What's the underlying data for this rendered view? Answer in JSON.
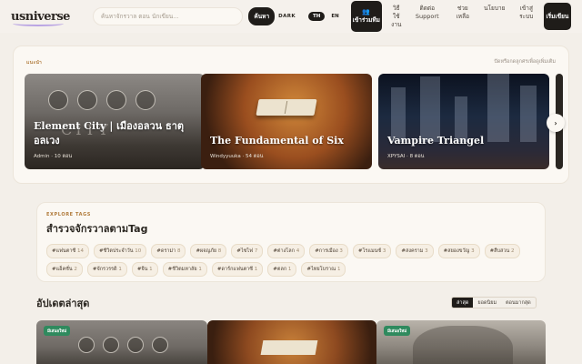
{
  "header": {
    "logo": "usniverse",
    "search_placeholder": "ค้นหาจักรวาล ตอน นักเขียน...",
    "search_button": "ค้นหา",
    "dark_toggle": "DARK",
    "lang_th": "TH",
    "lang_en": "EN",
    "join_label": "เข้าร่วมทีม",
    "nav": [
      {
        "label": "วิธีใช้งาน"
      },
      {
        "label": "ติดต่อ Support"
      },
      {
        "label": "ช่วยเหลือ"
      },
      {
        "label": "นโยบาย"
      },
      {
        "label": "เข้าสู่ระบบ"
      }
    ],
    "login_button": "เริ่มเขียน"
  },
  "hero": {
    "label": "แนะนำ",
    "hint": "ปัดหรือกดลูกศรเพื่อดูเพิ่มเติม",
    "cards": [
      {
        "title": "Element City | เมืองอลวน ธาตุอลเวง",
        "author": "Admin",
        "episodes": "10 ตอน",
        "art_text": "CITY"
      },
      {
        "title": "The Fundamental of Six",
        "author": "Windyyuuka",
        "episodes": "54 ตอน"
      },
      {
        "title": "Vampire Triangel",
        "author": "XPYSAI",
        "episodes": "8 ตอน"
      }
    ]
  },
  "tags": {
    "eyebrow": "EXPLORE TAGS",
    "title": "สำรวจจักรวาลตามTag",
    "items": [
      {
        "name": "#แฟนตาซี",
        "count": "14"
      },
      {
        "name": "#ชีวิตประจำวัน",
        "count": "10"
      },
      {
        "name": "#ดราม่า",
        "count": "8"
      },
      {
        "name": "#ผจญภัย",
        "count": "8"
      },
      {
        "name": "#ไซไฟ",
        "count": "7"
      },
      {
        "name": "#ต่างโลก",
        "count": "4"
      },
      {
        "name": "#การเมือง",
        "count": "3"
      },
      {
        "name": "#โรแมนซ์",
        "count": "3"
      },
      {
        "name": "#สงคราม",
        "count": "3"
      },
      {
        "name": "#สยองขวัญ",
        "count": "3"
      },
      {
        "name": "#สืบสวน",
        "count": "2"
      },
      {
        "name": "#แอ็คชั่น",
        "count": "2"
      },
      {
        "name": "#จักรวรรดิ",
        "count": "1"
      },
      {
        "name": "#จีน",
        "count": "1"
      },
      {
        "name": "#ชีวิตมหาลัย",
        "count": "1"
      },
      {
        "name": "#ดาร์กแฟนตาซี",
        "count": "1"
      },
      {
        "name": "#ตลก",
        "count": "1"
      },
      {
        "name": "#ไทยโบราณ",
        "count": "1"
      }
    ]
  },
  "latest": {
    "title": "อัปเดตล่าสุด",
    "tabs": [
      "ล่าสุด",
      "ยอดนิยม",
      "ตอนมากสุด"
    ],
    "badge": "มีเสนอใหม่"
  },
  "colors": {
    "accent": "#1f1c19",
    "eyebrow": "#b07a3a",
    "badge": "#2f8a5e"
  }
}
